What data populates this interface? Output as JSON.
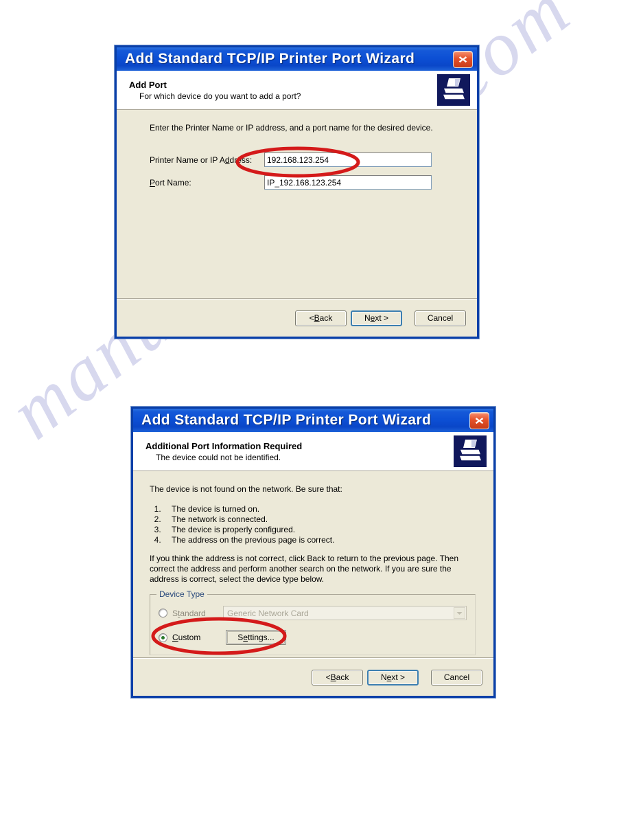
{
  "watermark": {
    "text": "manualsarchive.com"
  },
  "dialog1": {
    "title": "Add Standard TCP/IP Printer Port Wizard",
    "close_label": "Close",
    "header": {
      "title": "Add Port",
      "subtitle": "For which device do you want to add a port?",
      "icon": "printer-icon"
    },
    "intro": "Enter the Printer Name or IP address, and a port name for the desired device.",
    "fields": [
      {
        "label_a": "Printer Name or IP A",
        "label_u": "d",
        "label_b": "dress:",
        "value": "192.168.123.254"
      },
      {
        "label_a": "",
        "label_u": "P",
        "label_b": "ort Name:",
        "value": "IP_192.168.123.254"
      }
    ],
    "buttons": {
      "back_a": "< ",
      "back_u": "B",
      "back_b": "ack",
      "next_a": "N",
      "next_u": "e",
      "next_b": "xt >",
      "cancel": "Cancel"
    }
  },
  "dialog2": {
    "title": "Add Standard TCP/IP Printer Port Wizard",
    "close_label": "Close",
    "header": {
      "title": "Additional Port Information Required",
      "subtitle": "The device could not be identified.",
      "icon": "printer-icon"
    },
    "message": "The device is not found on the network.  Be sure that:",
    "checks": [
      "The device is turned on.",
      "The network is connected.",
      "The device is properly configured.",
      "The address on the previous page is correct."
    ],
    "paragraph": "If you think the address is not correct, click Back to return to the previous page.  Then correct the address and perform another search on the network.  If you are sure the address is correct, select the device type below.",
    "device_type": {
      "legend": "Device Type",
      "standard": {
        "label_a": "S",
        "label_u": "t",
        "label_b": "andard",
        "selected": false,
        "combo_value": "Generic Network Card",
        "disabled": true
      },
      "custom": {
        "label_a": "",
        "label_u": "C",
        "label_b": "ustom",
        "selected": true,
        "settings_a": "S",
        "settings_u": "e",
        "settings_b": "ttings..."
      }
    },
    "buttons": {
      "back_a": "< ",
      "back_u": "B",
      "back_b": "ack",
      "next_a": "N",
      "next_u": "e",
      "next_b": "xt >",
      "cancel": "Cancel"
    }
  },
  "annotations": {
    "ellipse_color": "#d41a1a",
    "ellipse_1_target": "printer-name-ip-field",
    "ellipse_2_target": "custom-radio-and-settings"
  }
}
